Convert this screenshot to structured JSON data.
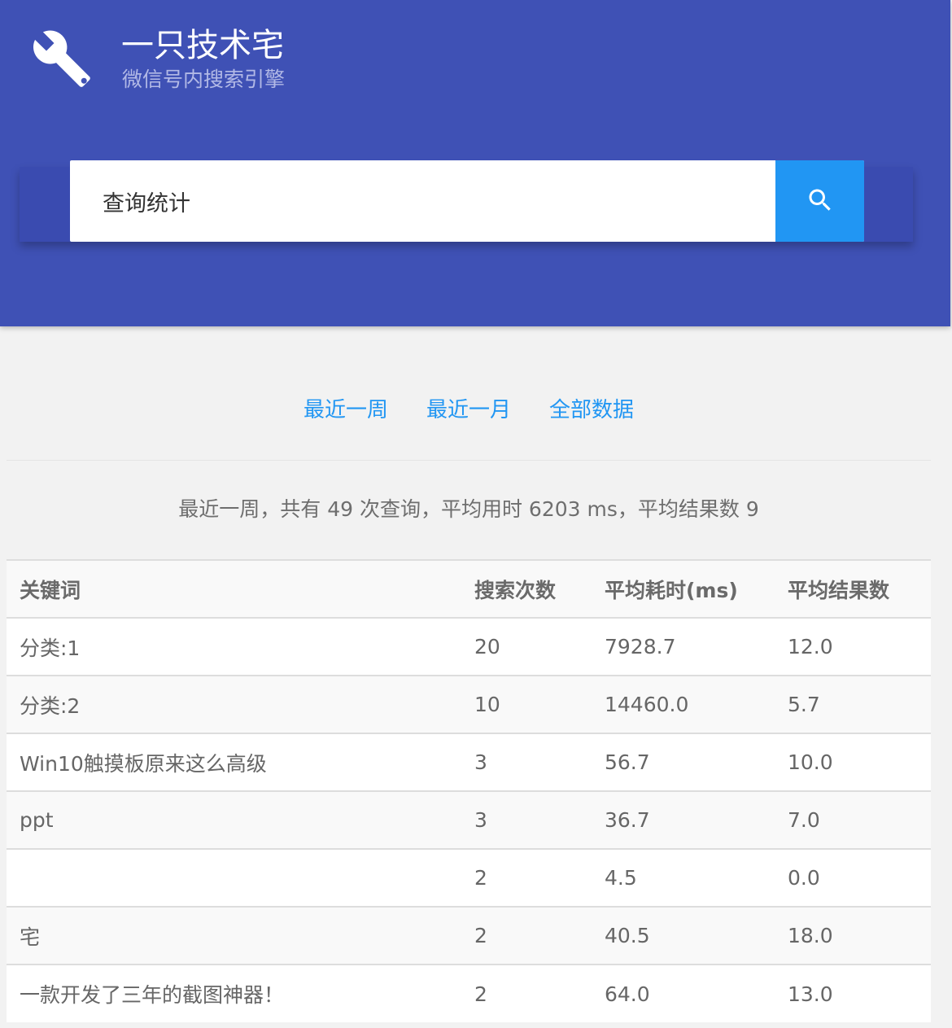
{
  "brand": {
    "title": "一只技术宅",
    "subtitle": "微信号内搜索引擎"
  },
  "search": {
    "value": "查询统计"
  },
  "colors": {
    "header": "#3f51b5",
    "accent": "#2196f3"
  },
  "icons": {
    "logo": "wrench-icon",
    "search": "search-icon"
  },
  "filters": [
    "最近一周",
    "最近一月",
    "全部数据"
  ],
  "summary": "最近一周，共有 49 次查询，平均用时 6203 ms，平均结果数 9",
  "table": {
    "headers": [
      "关键词",
      "搜索次数",
      "平均耗时(ms)",
      "平均结果数"
    ],
    "rows": [
      [
        "分类:1",
        "20",
        "7928.7",
        "12.0"
      ],
      [
        "分类:2",
        "10",
        "14460.0",
        "5.7"
      ],
      [
        "Win10触摸板原来这么高级",
        "3",
        "56.7",
        "10.0"
      ],
      [
        "ppt",
        "3",
        "36.7",
        "7.0"
      ],
      [
        "",
        "2",
        "4.5",
        "0.0"
      ],
      [
        "宅",
        "2",
        "40.5",
        "18.0"
      ],
      [
        "一款开发了三年的截图神器！",
        "2",
        "64.0",
        "13.0"
      ]
    ]
  }
}
